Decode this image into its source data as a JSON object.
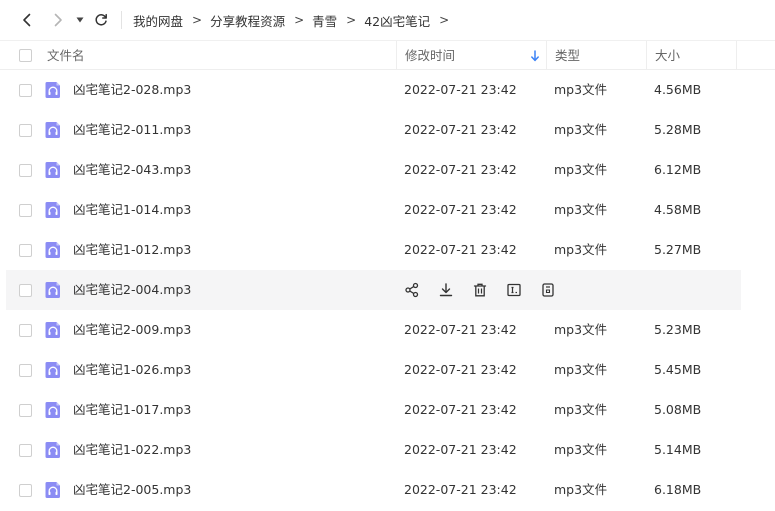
{
  "breadcrumb": [
    "我的网盘",
    "分享教程资源",
    "青雪",
    "42凶宅笔记"
  ],
  "columns": {
    "name": "文件名",
    "modified": "修改时间",
    "type": "类型",
    "size": "大小"
  },
  "sort": {
    "column": "modified",
    "direction": "desc"
  },
  "hover_row_index": 5,
  "row_actions": [
    "share-icon",
    "download-icon",
    "delete-icon",
    "rename-icon",
    "more-icon"
  ],
  "colors": {
    "accent": "#3b82f6",
    "file_icon": "#8b8cf4",
    "hover_bg": "#f5f5f6"
  },
  "files": [
    {
      "name": "凶宅笔记2-028.mp3",
      "modified": "2022-07-21 23:42",
      "type": "mp3文件",
      "size": "4.56MB"
    },
    {
      "name": "凶宅笔记2-011.mp3",
      "modified": "2022-07-21 23:42",
      "type": "mp3文件",
      "size": "5.28MB"
    },
    {
      "name": "凶宅笔记2-043.mp3",
      "modified": "2022-07-21 23:42",
      "type": "mp3文件",
      "size": "6.12MB"
    },
    {
      "name": "凶宅笔记1-014.mp3",
      "modified": "2022-07-21 23:42",
      "type": "mp3文件",
      "size": "4.58MB"
    },
    {
      "name": "凶宅笔记1-012.mp3",
      "modified": "2022-07-21 23:42",
      "type": "mp3文件",
      "size": "5.27MB"
    },
    {
      "name": "凶宅笔记2-004.mp3"
    },
    {
      "name": "凶宅笔记2-009.mp3",
      "modified": "2022-07-21 23:42",
      "type": "mp3文件",
      "size": "5.23MB"
    },
    {
      "name": "凶宅笔记1-026.mp3",
      "modified": "2022-07-21 23:42",
      "type": "mp3文件",
      "size": "5.45MB"
    },
    {
      "name": "凶宅笔记1-017.mp3",
      "modified": "2022-07-21 23:42",
      "type": "mp3文件",
      "size": "5.08MB"
    },
    {
      "name": "凶宅笔记1-022.mp3",
      "modified": "2022-07-21 23:42",
      "type": "mp3文件",
      "size": "5.14MB"
    },
    {
      "name": "凶宅笔记2-005.mp3",
      "modified": "2022-07-21 23:42",
      "type": "mp3文件",
      "size": "6.18MB"
    }
  ]
}
